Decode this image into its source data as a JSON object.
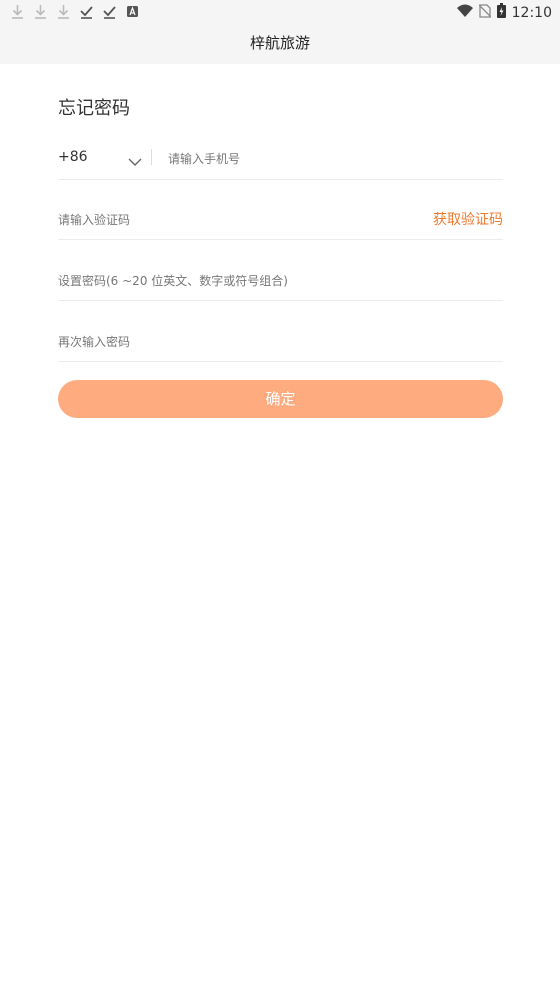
{
  "status_bar": {
    "time": "12:10",
    "left_icons": [
      "download-icon",
      "download-icon",
      "download-icon",
      "check-icon",
      "check-icon",
      "font-a-icon"
    ],
    "right_icons": [
      "wifi-icon",
      "no-sim-icon",
      "battery-icon"
    ]
  },
  "header": {
    "title": "梓航旅游"
  },
  "form": {
    "heading": "忘记密码",
    "country_code": "+86",
    "phone_placeholder": "请输入手机号",
    "code_placeholder": "请输入验证码",
    "get_code_label": "获取验证码",
    "password_placeholder": "设置密码(6 ~20 位英文、数字或符号组合)",
    "confirm_password_placeholder": "再次输入密码",
    "submit_label": "确定"
  },
  "colors": {
    "accent": "#ee7a30",
    "button_bg": "#ffab80",
    "bar_bg": "#f5f5f5"
  }
}
